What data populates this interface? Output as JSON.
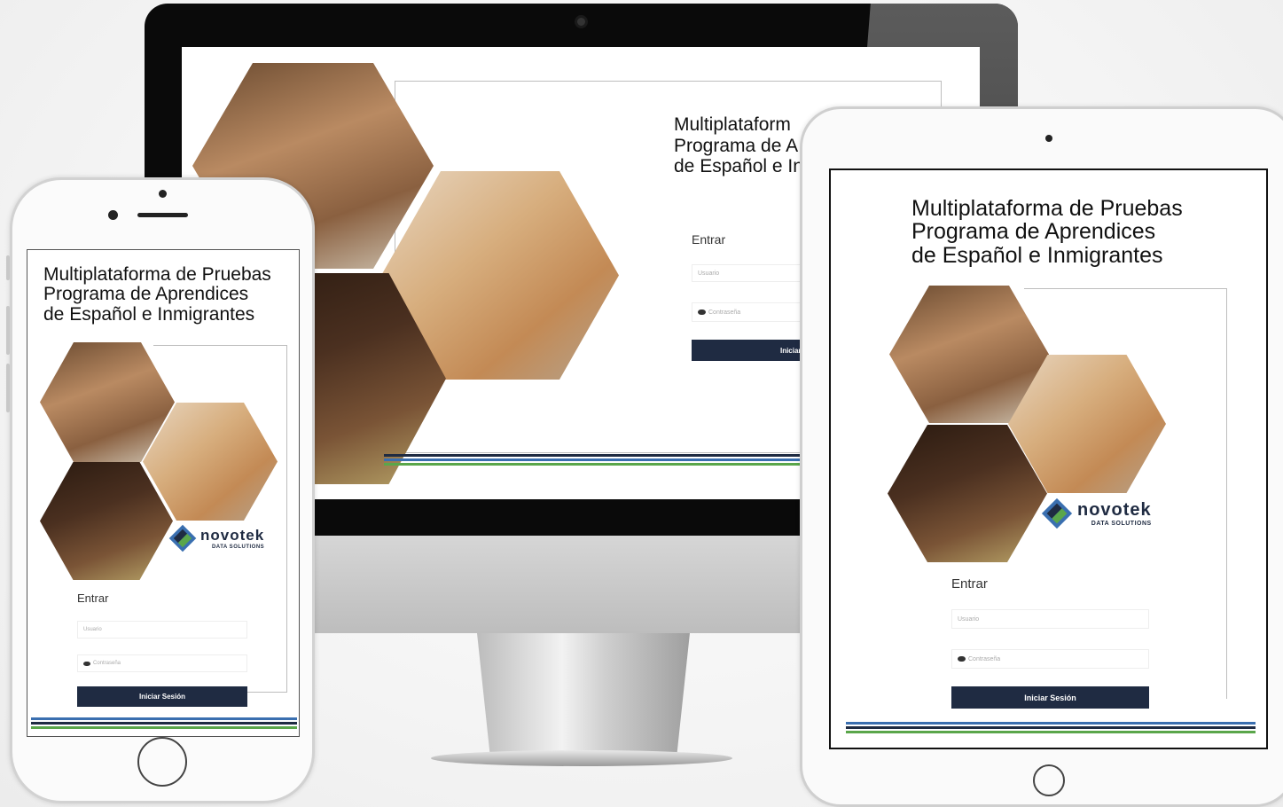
{
  "app": {
    "title_lines": [
      "Multiplataforma de Pruebas",
      "Programa de Aprendices",
      "de Español e Inmigrantes"
    ],
    "login_heading": "Entrar",
    "username_placeholder": "Usuario",
    "password_placeholder": "Contraseña",
    "submit_label": "Iniciar Sesión",
    "desktop_submit_visible": "Iniciar Ses",
    "desktop_title_lines": [
      "Multiplataform",
      "Programa de A",
      "de Español e In"
    ]
  },
  "logo": {
    "name": "novotek",
    "tagline": "DATA SOLUTIONS"
  },
  "colors": {
    "button": "#1f2b42",
    "stripe_blue": "#3a6fb0",
    "stripe_green": "#5aa64a",
    "stripe_navy": "#1f2b42"
  },
  "icons": {
    "password": "eye-icon",
    "photos": "hexagon-photo"
  }
}
